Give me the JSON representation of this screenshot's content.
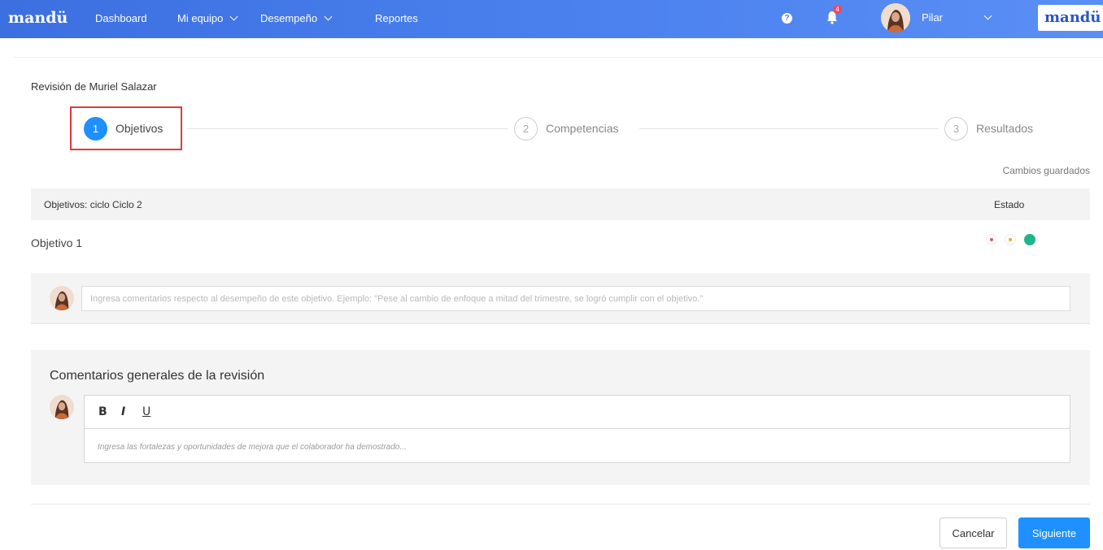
{
  "navbar": {
    "logo": "mandü",
    "links": [
      {
        "label": "Dashboard"
      },
      {
        "label": "Mi equipo"
      },
      {
        "label": "Desempeño"
      },
      {
        "label": "Reportes"
      }
    ],
    "help_glyph": "?",
    "notification_count": "4",
    "user_name": "Pilar",
    "brand": "mandü"
  },
  "page": {
    "title": "Revisión de Muriel Salazar",
    "saved_status": "Cambios guardados"
  },
  "stepper": {
    "steps": [
      {
        "number": "1",
        "label": "Objetivos",
        "state": "active"
      },
      {
        "number": "2",
        "label": "Competencias",
        "state": "inactive"
      },
      {
        "number": "3",
        "label": "Resultados",
        "state": "inactive"
      }
    ]
  },
  "objectives": {
    "header_left": "Objetivos: ciclo Ciclo 2",
    "header_right": "Estado",
    "items": [
      {
        "name": "Objetivo 1",
        "status_colors": [
          "#e05252",
          "#f2a33a",
          "#1fb58c"
        ],
        "selected_status": 2,
        "comment_placeholder": "Ingresa comentarios respecto al desempeño de este objetivo. Ejemplo: \"Pese al cambio de enfoque a mitad del trimestre, se logró cumplir con el objetivo.\""
      }
    ]
  },
  "general_comments": {
    "title": "Comentarios generales de la revisión",
    "toolbar": {
      "bold": "B",
      "italic": "I",
      "underline": "U"
    },
    "placeholder": "Ingresa las fortalezas y oportunidades de mejora que el colaborador ha demostrado..."
  },
  "actions": {
    "cancel": "Cancelar",
    "next": "Siguiente"
  },
  "colors": {
    "primary": "#1e90ff",
    "navbar": "#4a80ee",
    "highlight": "#e23a3a"
  }
}
